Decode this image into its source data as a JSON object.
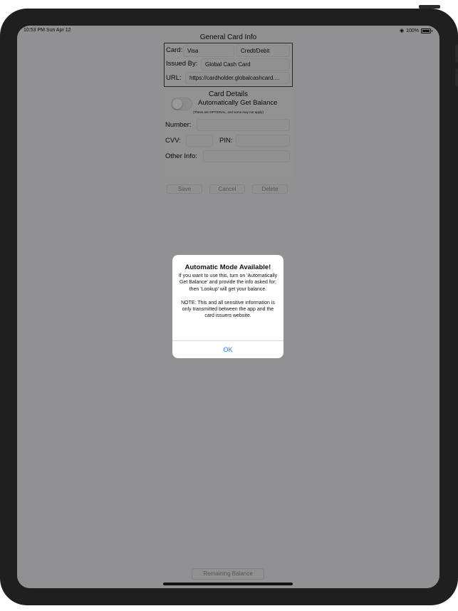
{
  "status_bar": {
    "time": "10:53 PM  Sun Apr 12",
    "battery_text": "100%",
    "wifi_icon": "wifi-icon",
    "battery_icon": "battery-icon"
  },
  "general": {
    "title": "General Card Info",
    "card_label": "Card:",
    "card_value": "Visa",
    "card_type_value": "Credt/Debit",
    "issued_by_label": "Issued By:",
    "issued_by_value": "Global Cash Card",
    "url_label": "URL:",
    "url_value": "https://cardholder.globalcashcard...."
  },
  "details": {
    "title": "Card Details",
    "auto_balance_label": "Automatically Get Balance",
    "auto_balance_on": false,
    "note": "(These are OPTIONAL, and some may not apply)",
    "number_label": "Number:",
    "cvv_label": "CVV:",
    "pin_label": "PIN:",
    "other_info_label": "Other Info:"
  },
  "actions": {
    "save": "Save",
    "cancel": "Cancel",
    "delete": "Delete"
  },
  "bottom_button": "Remaining Balance",
  "alert": {
    "title": "Automatic Mode Available!",
    "message": "If you want to use this, turn on 'Automatically Get Balance' and provide the info asked for; then 'Lookup' will get your balance.\n\nNOTE: This and all sensitive information is only transmitted between the app and the card issuers website.",
    "ok": "OK"
  },
  "colors": {
    "alert_button": "#1a7cf5",
    "dim_overlay": "rgba(0,0,0,0.40)"
  }
}
